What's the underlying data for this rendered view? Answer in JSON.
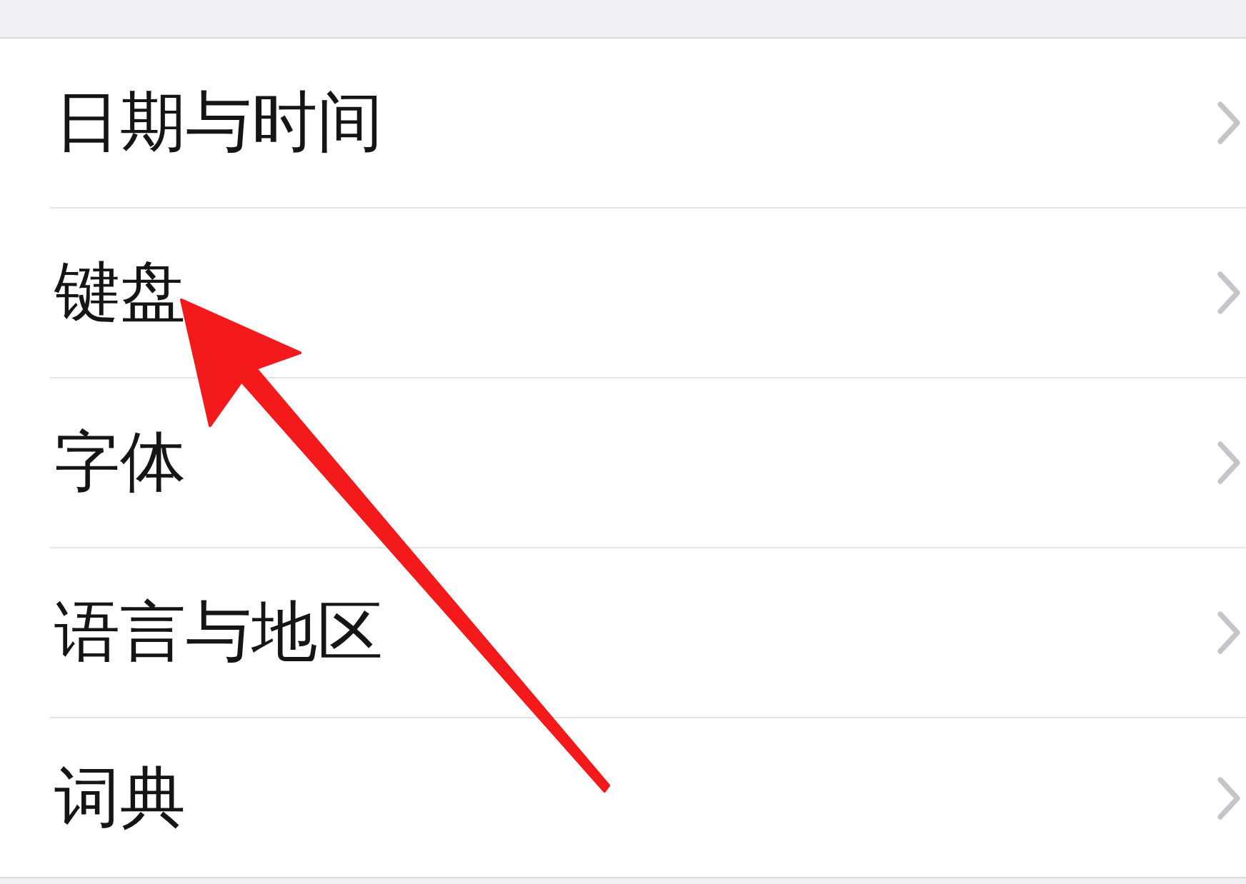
{
  "items": [
    {
      "label": "日期与时间",
      "marked": false
    },
    {
      "label": "键盘",
      "marked": true
    },
    {
      "label": "字体",
      "marked": false
    },
    {
      "label": "语言与地区",
      "marked": false
    },
    {
      "label": "词典",
      "marked": false
    }
  ]
}
